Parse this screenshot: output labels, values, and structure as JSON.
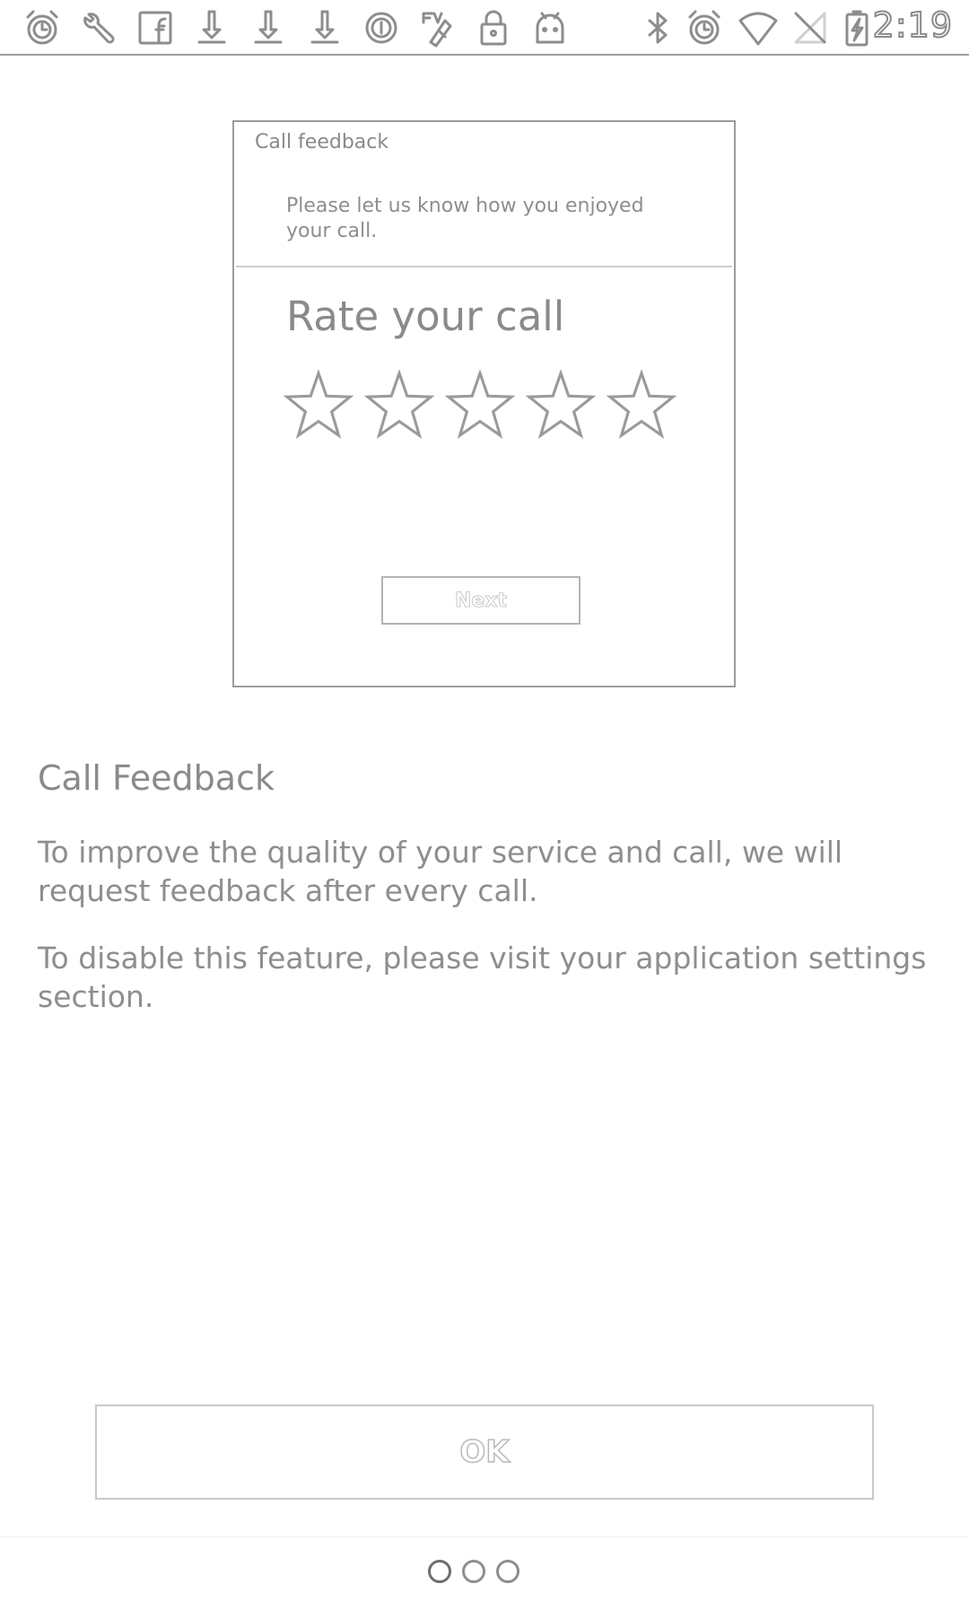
{
  "status_bar": {
    "time": "2:19",
    "left_icons": [
      "alarm-icon",
      "wrench-icon",
      "facebook-icon",
      "download-icon",
      "download-icon",
      "download-icon",
      "circle-i-icon",
      "fav-icon",
      "lock-icon",
      "android-icon"
    ],
    "right_icons": [
      "bluetooth-icon",
      "alarm-icon",
      "wifi-icon",
      "no-signal-icon",
      "battery-charging-icon"
    ]
  },
  "preview": {
    "title": "Call feedback",
    "message": "Please let us know how you enjoyed your call.",
    "rate_label": "Rate your call",
    "rating": 0,
    "max_rating": 5,
    "next_label": "Next"
  },
  "content": {
    "heading": "Call Feedback",
    "paragraph1": "To improve the quality of your service and call, we will request feedback after every call.",
    "paragraph2": "To disable this feature, please visit your application settings section."
  },
  "ok_label": "OK",
  "pager": {
    "pages": 3,
    "current": 1
  }
}
